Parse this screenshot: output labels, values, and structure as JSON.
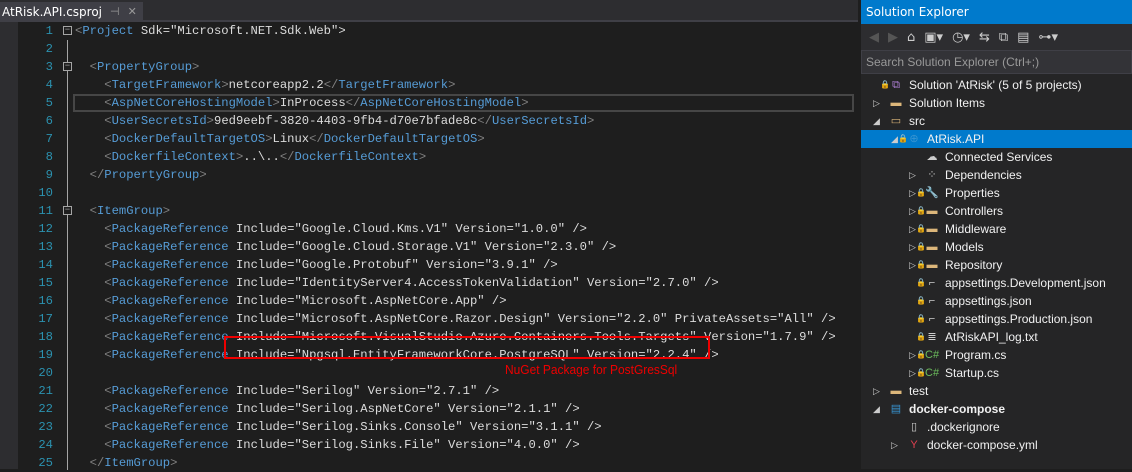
{
  "tab": {
    "title": "AtRisk.API.csproj",
    "pin_icon": "pin-icon",
    "close_icon": "close-icon"
  },
  "code_lines": [
    "<Project Sdk=\"Microsoft.NET.Sdk.Web\">",
    "",
    "  <PropertyGroup>",
    "    <TargetFramework>netcoreapp2.2</TargetFramework>",
    "    <AspNetCoreHostingModel>InProcess</AspNetCoreHostingModel>",
    "    <UserSecretsId>9ed9eebf-3820-4403-9fb4-d70e7bfade8c</UserSecretsId>",
    "    <DockerDefaultTargetOS>Linux</DockerDefaultTargetOS>",
    "    <DockerfileContext>..\\..</DockerfileContext>",
    "  </PropertyGroup>",
    "",
    "  <ItemGroup>",
    "    <PackageReference Include=\"Google.Cloud.Kms.V1\" Version=\"1.0.0\" />",
    "    <PackageReference Include=\"Google.Cloud.Storage.V1\" Version=\"2.3.0\" />",
    "    <PackageReference Include=\"Google.Protobuf\" Version=\"3.9.1\" />",
    "    <PackageReference Include=\"IdentityServer4.AccessTokenValidation\" Version=\"2.7.0\" />",
    "    <PackageReference Include=\"Microsoft.AspNetCore.App\" />",
    "    <PackageReference Include=\"Microsoft.AspNetCore.Razor.Design\" Version=\"2.2.0\" PrivateAssets=\"All\" />",
    "    <PackageReference Include=\"Microsoft.VisualStudio.Azure.Containers.Tools.Targets\" Version=\"1.7.9\" />",
    "    <PackageReference Include=\"Npgsql.EntityFrameworkCore.PostgreSQL\" Version=\"2.2.4\" />",
    "",
    "    <PackageReference Include=\"Serilog\" Version=\"2.7.1\" />",
    "    <PackageReference Include=\"Serilog.AspNetCore\" Version=\"2.1.1\" />",
    "    <PackageReference Include=\"Serilog.Sinks.Console\" Version=\"3.1.1\" />",
    "    <PackageReference Include=\"Serilog.Sinks.File\" Version=\"4.0.0\" />",
    "  </ItemGroup>"
  ],
  "current_line": 5,
  "annotation": "NuGet Package for PostGresSql",
  "solution_explorer": {
    "title": "Solution Explorer",
    "search_placeholder": "Search Solution Explorer (Ctrl+;)",
    "toolbar": [
      "back-icon",
      "forward-icon",
      "home-icon",
      "switch-views-icon",
      "history-icon",
      "sync-icon",
      "collapse-all-icon",
      "show-all-files-icon",
      "properties-icon"
    ],
    "items": [
      {
        "label": "Solution 'AtRisk' (5 of 5 projects)",
        "level": 0,
        "exp": "",
        "icon": "solution-icon",
        "lock": true
      },
      {
        "label": "Solution Items",
        "level": 0,
        "exp": "right",
        "icon": "folder-icon"
      },
      {
        "label": "src",
        "level": 0,
        "exp": "down",
        "icon": "folder-open-icon"
      },
      {
        "label": "AtRisk.API",
        "level": 1,
        "exp": "down",
        "icon": "web-project-icon",
        "lock": true,
        "selected": true
      },
      {
        "label": "Connected Services",
        "level": 2,
        "exp": "",
        "icon": "connected-services-icon"
      },
      {
        "label": "Dependencies",
        "level": 2,
        "exp": "right",
        "icon": "dependencies-icon"
      },
      {
        "label": "Properties",
        "level": 2,
        "exp": "right",
        "icon": "wrench-icon",
        "lock": true
      },
      {
        "label": "Controllers",
        "level": 2,
        "exp": "right",
        "icon": "folder-icon",
        "lock": true
      },
      {
        "label": "Middleware",
        "level": 2,
        "exp": "right",
        "icon": "folder-icon",
        "lock": true
      },
      {
        "label": "Models",
        "level": 2,
        "exp": "right",
        "icon": "folder-icon",
        "lock": true
      },
      {
        "label": "Repository",
        "level": 2,
        "exp": "right",
        "icon": "folder-icon",
        "lock": true
      },
      {
        "label": "appsettings.Development.json",
        "level": 2,
        "exp": "",
        "icon": "json-file-icon",
        "lock": true
      },
      {
        "label": "appsettings.json",
        "level": 2,
        "exp": "",
        "icon": "json-file-icon",
        "lock": true
      },
      {
        "label": "appsettings.Production.json",
        "level": 2,
        "exp": "",
        "icon": "json-file-icon",
        "lock": true
      },
      {
        "label": "AtRiskAPI_log.txt",
        "level": 2,
        "exp": "",
        "icon": "text-file-icon",
        "lock": true
      },
      {
        "label": "Program.cs",
        "level": 2,
        "exp": "right",
        "icon": "csharp-file-icon",
        "lock": true
      },
      {
        "label": "Startup.cs",
        "level": 2,
        "exp": "right",
        "icon": "csharp-file-icon",
        "lock": true
      },
      {
        "label": "test",
        "level": 0,
        "exp": "right",
        "icon": "folder-icon"
      },
      {
        "label": "docker-compose",
        "level": 0,
        "exp": "down",
        "icon": "docker-compose-icon",
        "bold": true
      },
      {
        "label": ".dockerignore",
        "level": 1,
        "exp": "",
        "icon": "file-icon"
      },
      {
        "label": "docker-compose.yml",
        "level": 1,
        "exp": "right",
        "icon": "yaml-file-icon"
      }
    ]
  },
  "colors": {
    "accent": "#007acc",
    "highlight_box": "#ee0000"
  }
}
